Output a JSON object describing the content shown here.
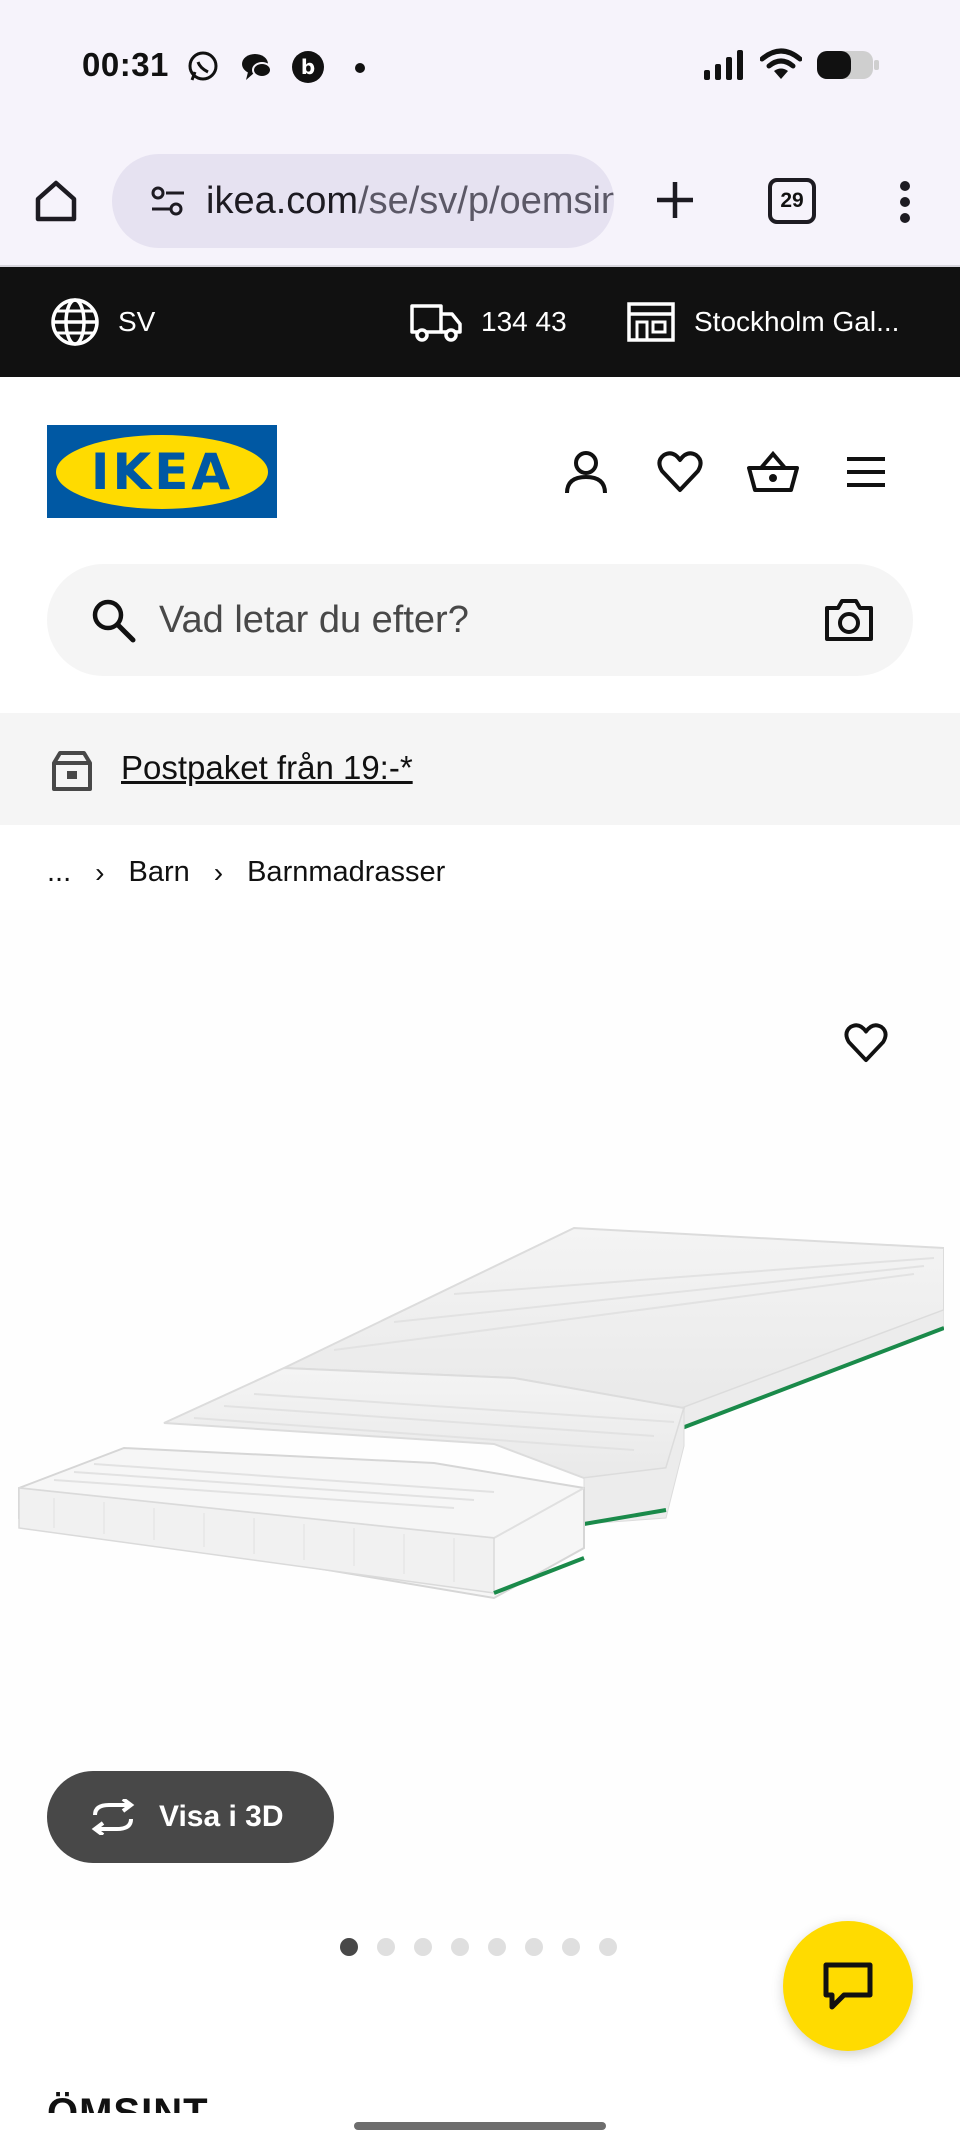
{
  "status_bar": {
    "time": "00:31",
    "left_icons": [
      "whatsapp-icon",
      "chat-bubbles-icon",
      "beeper-icon",
      "dot-icon"
    ],
    "right_icons": [
      "signal-icon",
      "wifi-icon",
      "battery-icon"
    ]
  },
  "browser": {
    "url_host": "ikea.com",
    "url_path": "/se/sv/p/oemsin",
    "tab_count": "29",
    "icons": [
      "home-icon",
      "site-settings-icon",
      "plus-icon",
      "kebab-menu-icon"
    ]
  },
  "top_bar": {
    "language": "SV",
    "postal_code": "134 43",
    "store": "Stockholm Gal..."
  },
  "header": {
    "logo_text": "IKEA",
    "icons": [
      "account-icon",
      "heart-icon",
      "basket-icon",
      "hamburger-icon"
    ]
  },
  "search": {
    "placeholder": "Vad letar du efter?"
  },
  "banner": {
    "link_text": "Postpaket från 19:-*"
  },
  "breadcrumb": {
    "items": [
      "...",
      "Barn",
      "Barnmadrasser"
    ]
  },
  "product": {
    "view_3d_label": "Visa i 3D",
    "image_dots_total": 8,
    "image_dots_active_index": 0,
    "title_partial": "ÖMSINT"
  },
  "colors": {
    "ikea_blue": "#0058a3",
    "ikea_yellow": "#ffdb00",
    "topbar_bg": "#111111",
    "mattress_stripe": "#1a8a4a"
  }
}
